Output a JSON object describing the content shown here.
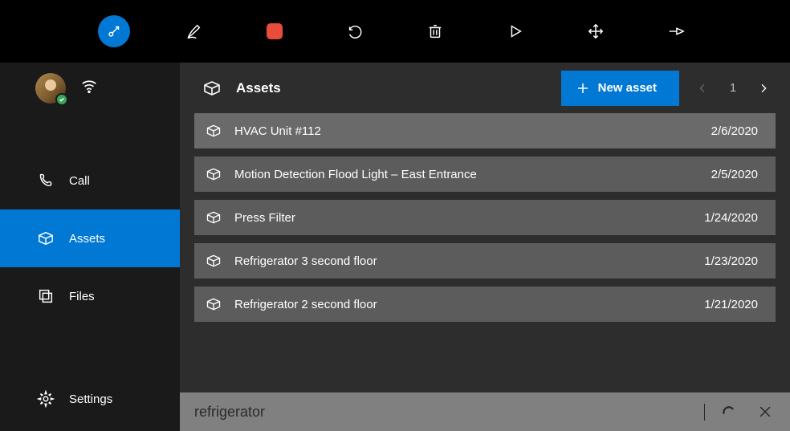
{
  "toolbar": {
    "items": [
      "ink-enter",
      "pen",
      "record",
      "undo",
      "delete",
      "play",
      "move",
      "pin"
    ]
  },
  "sidebar": {
    "nav": [
      {
        "id": "call",
        "label": "Call"
      },
      {
        "id": "assets",
        "label": "Assets",
        "active": true
      },
      {
        "id": "files",
        "label": "Files"
      },
      {
        "id": "settings",
        "label": "Settings"
      }
    ]
  },
  "header": {
    "title": "Assets",
    "new_button": "New asset",
    "pager": {
      "page": "1"
    }
  },
  "assets": [
    {
      "name": "HVAC Unit #112",
      "date": "2/6/2020"
    },
    {
      "name": "Motion Detection Flood Light – East Entrance",
      "date": "2/5/2020"
    },
    {
      "name": "Press Filter",
      "date": "1/24/2020"
    },
    {
      "name": "Refrigerator 3 second floor",
      "date": "1/23/2020"
    },
    {
      "name": "Refrigerator 2 second floor",
      "date": "1/21/2020"
    }
  ],
  "search": {
    "value": "refrigerator"
  }
}
